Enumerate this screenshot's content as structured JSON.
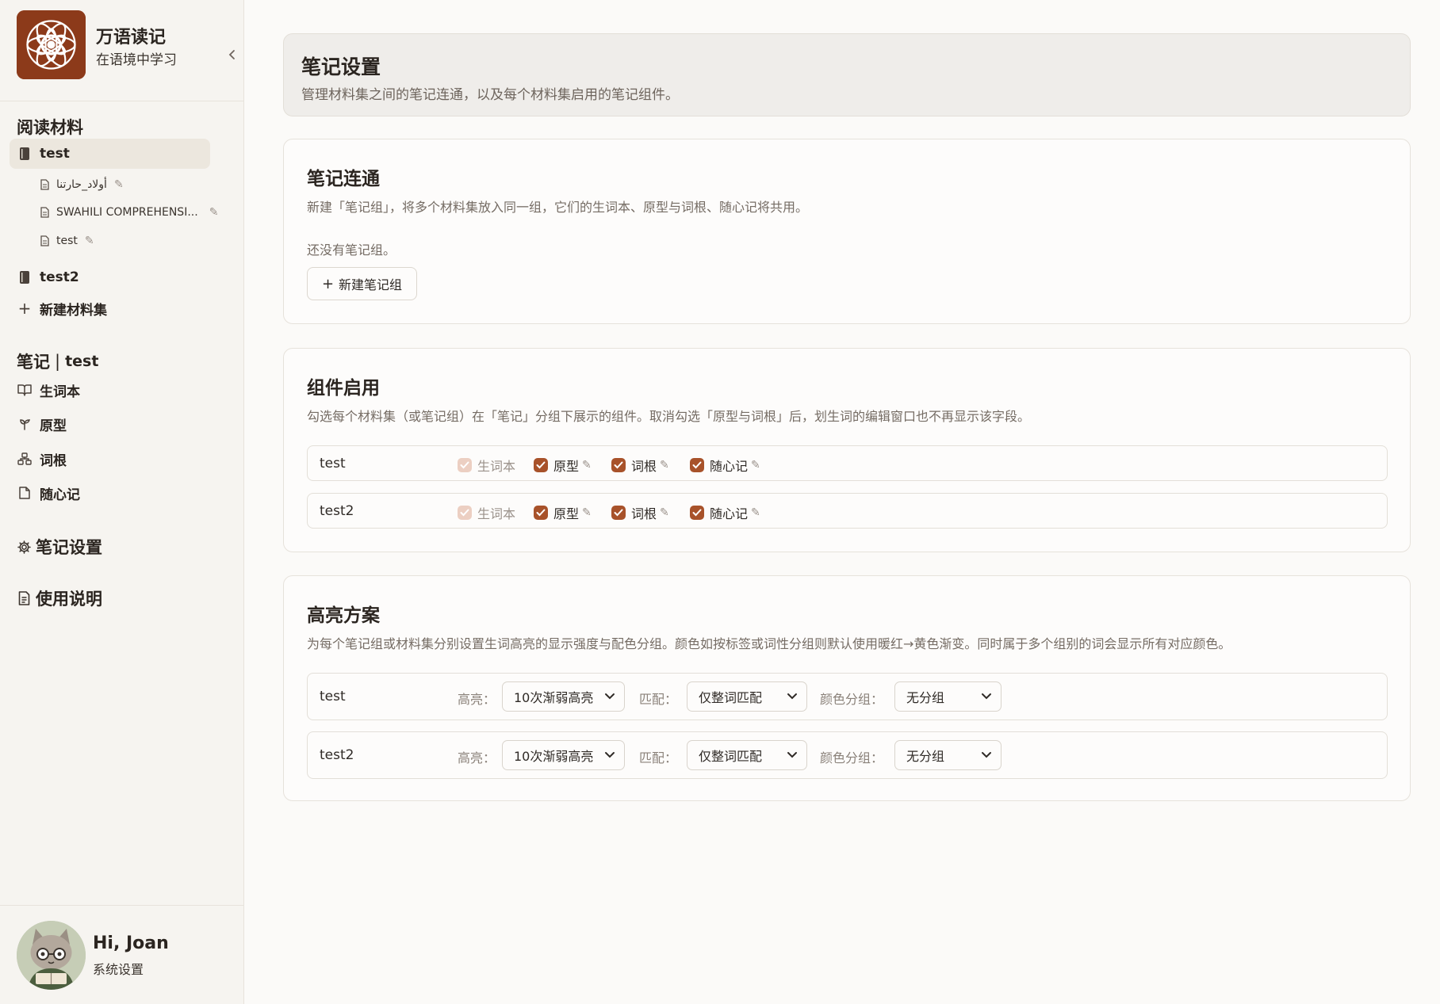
{
  "brand": {
    "name": "万语读记",
    "subtitle": "在语境中学习"
  },
  "sidebar": {
    "reading_title": "阅读材料",
    "collections": [
      {
        "label": "test",
        "items": [
          {
            "label": "أولاد_حارتنا"
          },
          {
            "label": "SWAHILI COMPREHENSI..."
          },
          {
            "label": "test"
          }
        ]
      },
      {
        "label": "test2"
      }
    ],
    "new_collection": "新建材料集",
    "notes_title": "笔记",
    "notes_sep": "|",
    "notes_current": "test",
    "notes_items": [
      {
        "label": "生词本",
        "icon": "book-open-icon"
      },
      {
        "label": "原型",
        "icon": "sprout-icon"
      },
      {
        "label": "词根",
        "icon": "network-icon"
      },
      {
        "label": "随心记",
        "icon": "file-icon"
      }
    ],
    "settings_label": "笔记设置",
    "help_label": "使用说明"
  },
  "user": {
    "greeting": "Hi, Joan",
    "settings": "系统设置"
  },
  "page": {
    "title": "笔记设置",
    "description": "管理材料集之间的笔记连通，以及每个材料集启用的笔记组件。"
  },
  "linking": {
    "title": "笔记连通",
    "description": "新建「笔记组」，将多个材料集放入同一组，它们的生词本、原型与词根、随心记将共用。",
    "empty": "还没有笔记组。",
    "new_button": "新建笔记组"
  },
  "components": {
    "title": "组件启用",
    "description": "勾选每个材料集（或笔记组）在「笔记」分组下展示的组件。取消勾选「原型与词根」后，划生词的编辑窗口也不再显示该字段。",
    "rows": [
      {
        "name": "test",
        "items": [
          {
            "label": "生词本",
            "checked": true,
            "disabled": true
          },
          {
            "label": "原型",
            "checked": true,
            "disabled": false
          },
          {
            "label": "词根",
            "checked": true,
            "disabled": false
          },
          {
            "label": "随心记",
            "checked": true,
            "disabled": false
          }
        ]
      },
      {
        "name": "test2",
        "items": [
          {
            "label": "生词本",
            "checked": true,
            "disabled": true
          },
          {
            "label": "原型",
            "checked": true,
            "disabled": false
          },
          {
            "label": "词根",
            "checked": true,
            "disabled": false
          },
          {
            "label": "随心记",
            "checked": true,
            "disabled": false
          }
        ]
      }
    ]
  },
  "highlight": {
    "title": "高亮方案",
    "description": "为每个笔记组或材料集分别设置生词高亮的显示强度与配色分组。颜色如按标签或词性分组则默认使用暖红→黄色渐变。同时属于多个组别的词会显示所有对应颜色。",
    "label_intensity": "高亮：",
    "label_match": "匹配：",
    "label_color": "颜色分组：",
    "rows": [
      {
        "name": "test",
        "intensity": "10次渐弱高亮",
        "match": "仅整词匹配",
        "color": "无分组"
      },
      {
        "name": "test2",
        "intensity": "10次渐弱高亮",
        "match": "仅整词匹配",
        "color": "无分组"
      }
    ]
  },
  "colors": {
    "accent": "#a8522a",
    "accent_disabled": "#eccfc2",
    "logo_bg": "#8c3a1a"
  }
}
